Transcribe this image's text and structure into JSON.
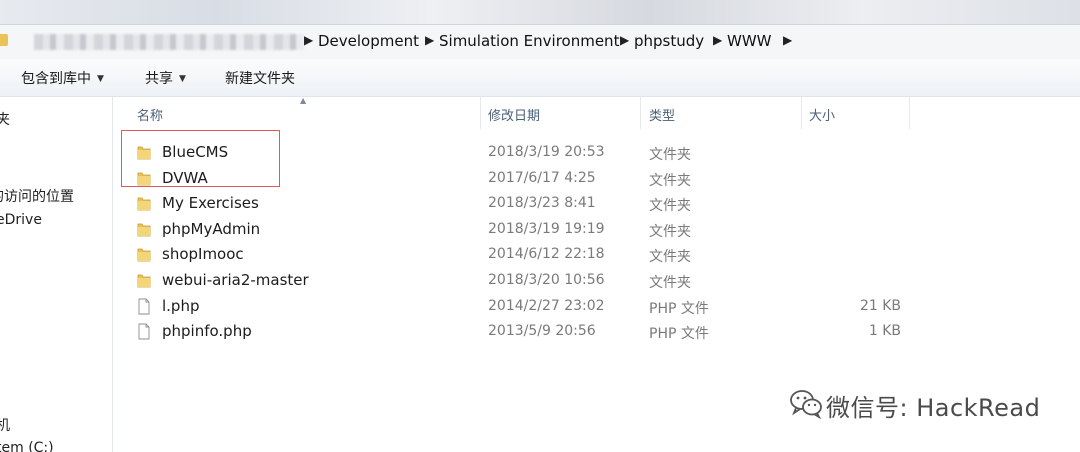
{
  "breadcrumb": [
    "Development",
    "Simulation Environment",
    "phpstudy",
    "WWW"
  ],
  "toolbar": {
    "include_library": "包含到库中",
    "share": "共享",
    "new_folder": "新建文件夹"
  },
  "nav": {
    "items": [
      "夹",
      "的访问的位置",
      "eDrive",
      "机",
      "tem (C:)"
    ]
  },
  "columns": {
    "name": "名称",
    "modified": "修改日期",
    "type": "类型",
    "size": "大小"
  },
  "files": [
    {
      "name": "BlueCMS",
      "modified": "2018/3/19 20:53",
      "type": "文件夹",
      "size": "",
      "kind": "folder"
    },
    {
      "name": "DVWA",
      "modified": "2017/6/17 4:25",
      "type": "文件夹",
      "size": "",
      "kind": "folder"
    },
    {
      "name": "My Exercises",
      "modified": "2018/3/23 8:41",
      "type": "文件夹",
      "size": "",
      "kind": "folder"
    },
    {
      "name": "phpMyAdmin",
      "modified": "2018/3/19 19:19",
      "type": "文件夹",
      "size": "",
      "kind": "folder"
    },
    {
      "name": "shopImooc",
      "modified": "2014/6/12 22:18",
      "type": "文件夹",
      "size": "",
      "kind": "folder"
    },
    {
      "name": "webui-aria2-master",
      "modified": "2018/3/20 10:56",
      "type": "文件夹",
      "size": "",
      "kind": "folder"
    },
    {
      "name": "l.php",
      "modified": "2014/2/27 23:02",
      "type": "PHP 文件",
      "size": "21 KB",
      "kind": "file"
    },
    {
      "name": "phpinfo.php",
      "modified": "2013/5/9 20:56",
      "type": "PHP 文件",
      "size": "1 KB",
      "kind": "file"
    }
  ],
  "watermark": {
    "text": "微信号: HackRead",
    "icon": "wechat-icon"
  },
  "colors": {
    "folder": "#e9c25a",
    "highlight": "#e0575c",
    "header_text": "#4c607a",
    "meta_text": "#7a7a7a"
  }
}
